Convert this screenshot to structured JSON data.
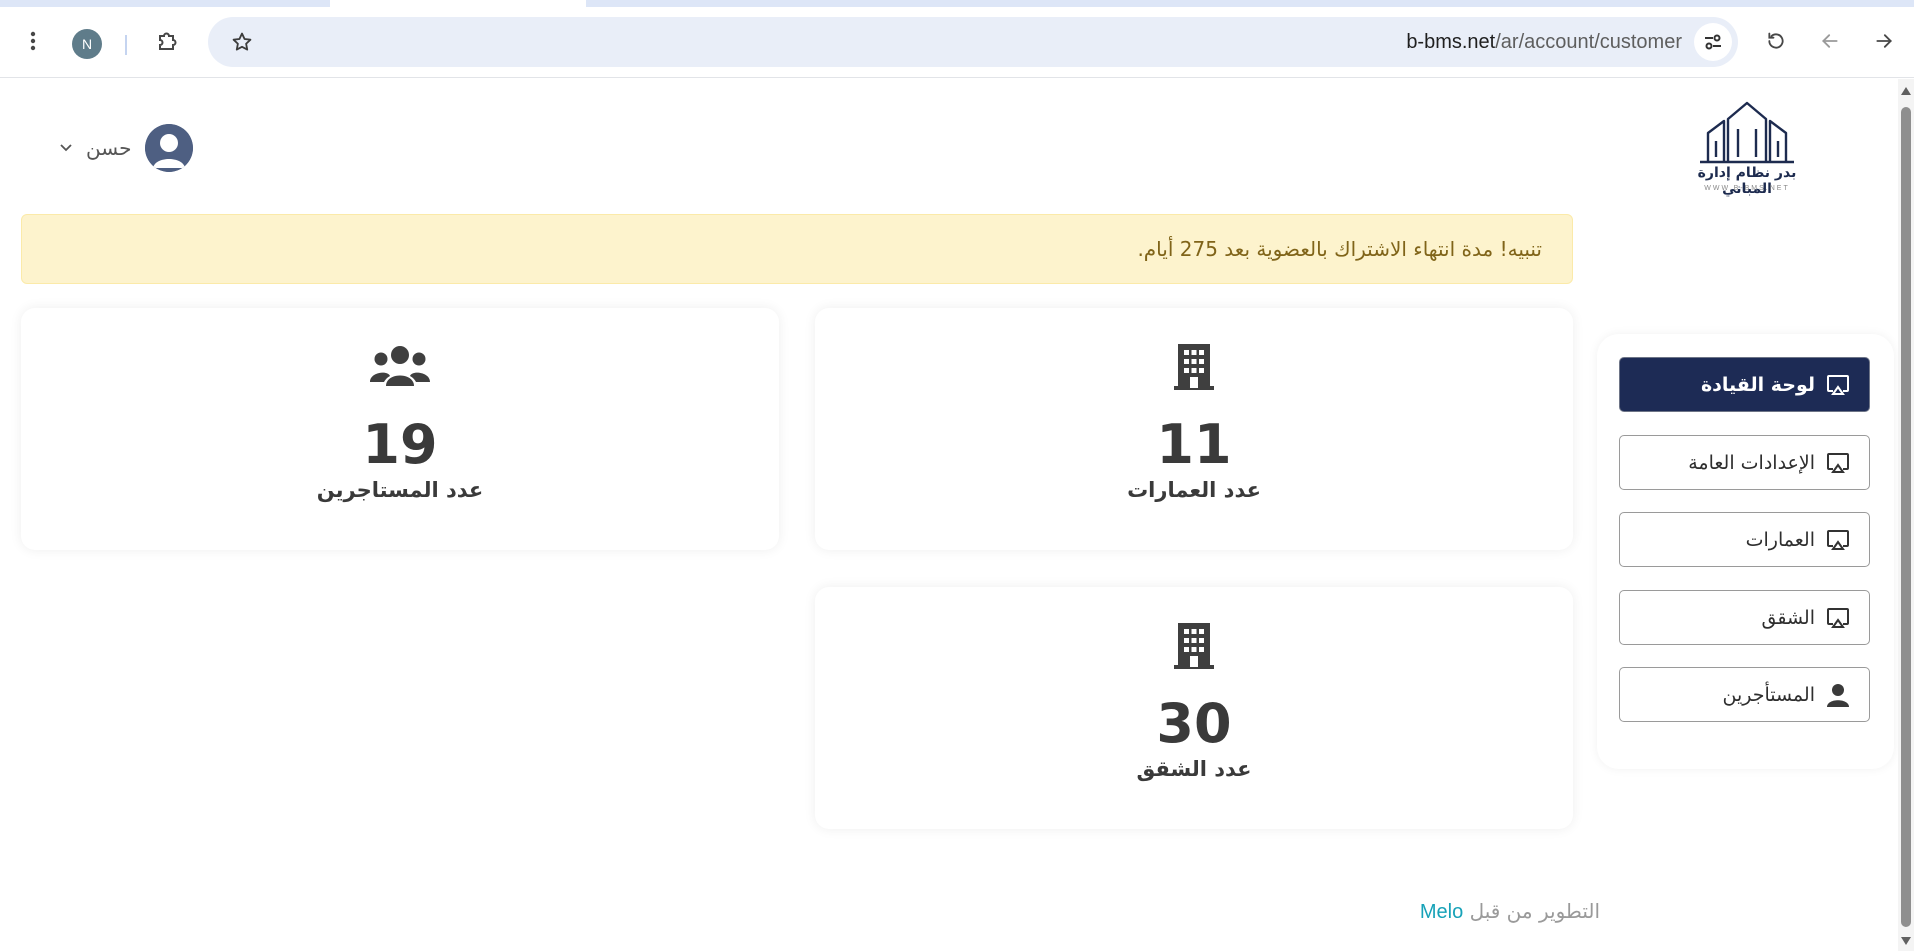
{
  "browser": {
    "profile_initial": "N",
    "url_host": "b-bms.net",
    "url_path": "/ar/account/customer",
    "icons": {
      "menu": "kebab-menu-icon",
      "extensions": "puzzle-icon",
      "bookmark": "star-icon",
      "site_settings": "tune-icon",
      "reload": "reload-icon",
      "back": "back-arrow-icon",
      "forward": "forward-arrow-icon"
    }
  },
  "header": {
    "logo_text": "بدر نظام إدارة المباني",
    "logo_url": "WWW.B-BMS.NET",
    "user_name": "حسن"
  },
  "alert": {
    "text": "تنبيه! مدة انتهاء الاشتراك بالعضوية بعد 275 أيام."
  },
  "sidebar": {
    "items": [
      {
        "label": "لوحة القيادة",
        "icon": "cast-icon",
        "active": true
      },
      {
        "label": "الإعدادات العامة",
        "icon": "cast-icon",
        "active": false
      },
      {
        "label": "العمارات",
        "icon": "cast-icon",
        "active": false
      },
      {
        "label": "الشقق",
        "icon": "cast-icon",
        "active": false
      },
      {
        "label": "المستأجرين",
        "icon": "user-icon",
        "active": false
      }
    ]
  },
  "stats": {
    "buildings": {
      "value": "11",
      "label": "عدد العمارات",
      "icon": "building-icon"
    },
    "tenants": {
      "value": "19",
      "label": "عدد المستاجرين",
      "icon": "users-icon"
    },
    "apartments": {
      "value": "30",
      "label": "عدد الشقق",
      "icon": "building-icon"
    }
  },
  "footer": {
    "prefix": "التطوير من قبل",
    "developer": "Melo"
  },
  "colors": {
    "primary": "#1d2b55",
    "alert_bg": "#fdf3cd",
    "alert_text": "#806419",
    "link": "#17a2b8"
  }
}
